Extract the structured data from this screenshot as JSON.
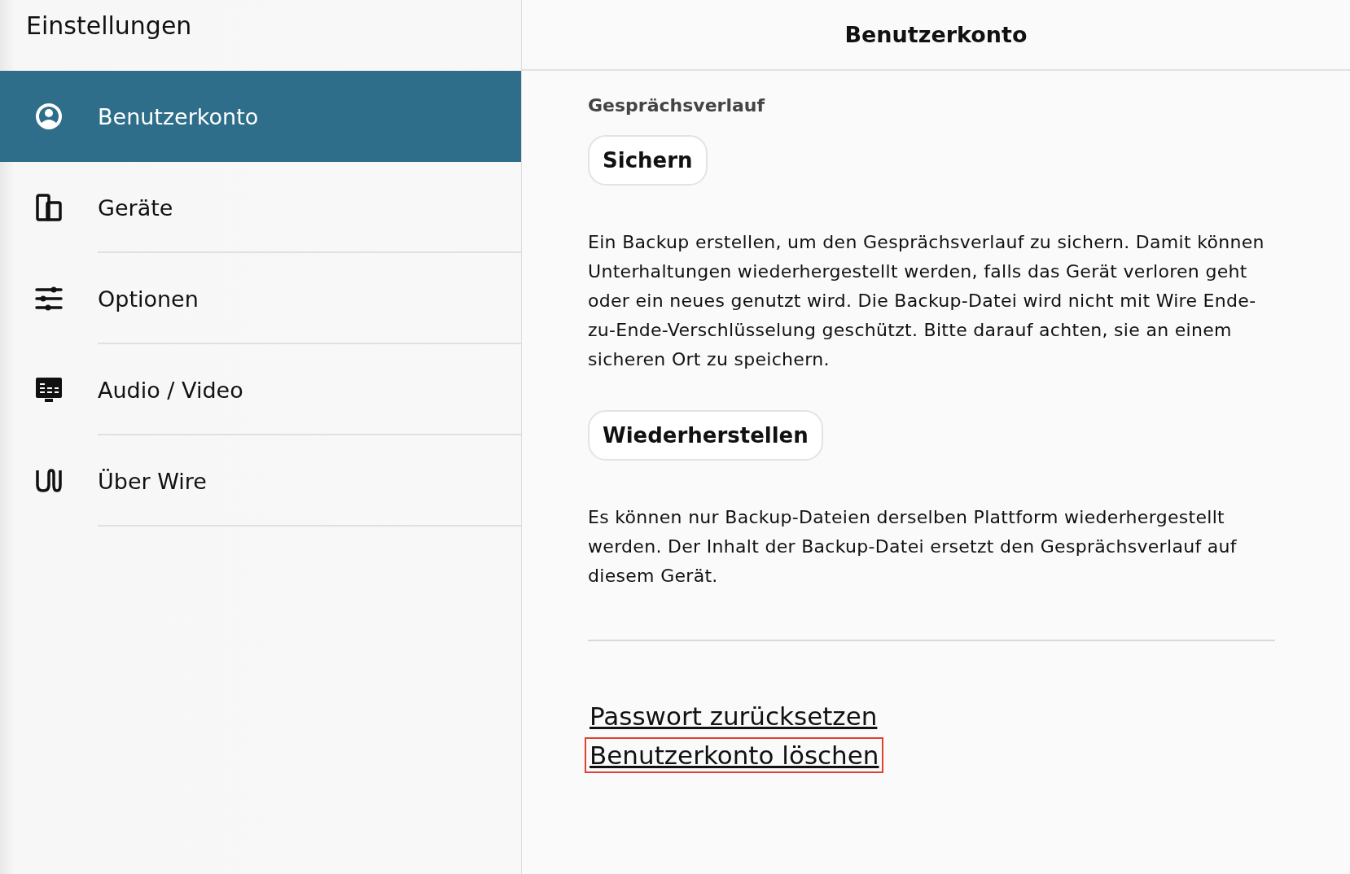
{
  "sidebar": {
    "title": "Einstellungen",
    "items": [
      {
        "label": "Benutzerkonto",
        "selected": true
      },
      {
        "label": "Geräte",
        "selected": false
      },
      {
        "label": "Optionen",
        "selected": false
      },
      {
        "label": "Audio / Video",
        "selected": false
      },
      {
        "label": "Über Wire",
        "selected": false
      }
    ]
  },
  "main": {
    "title": "Benutzerkonto",
    "section_heading": "Gesprächsverlauf",
    "blocks": [
      {
        "button": "Sichern",
        "text": "Ein Backup erstellen, um den Gesprächsverlauf zu sichern. Damit können Unterhaltungen wiederhergestellt werden, falls das Gerät verloren geht oder ein neues genutzt wird. Die Backup-Datei wird nicht mit Wire Ende-zu-Ende-Verschlüsselung geschützt. Bitte darauf achten, sie an einem sicheren Ort zu speichern."
      },
      {
        "button": "Wiederherstellen",
        "text": "Es können nur Backup-Dateien derselben Plattform wiederhergestellt werden. Der Inhalt der Backup-Datei ersetzt den Gesprächsverlauf auf diesem Gerät."
      }
    ],
    "links": [
      {
        "label": "Passwort zurücksetzen",
        "highlighted": false
      },
      {
        "label": "Benutzerkonto löschen",
        "highlighted": true
      }
    ]
  }
}
